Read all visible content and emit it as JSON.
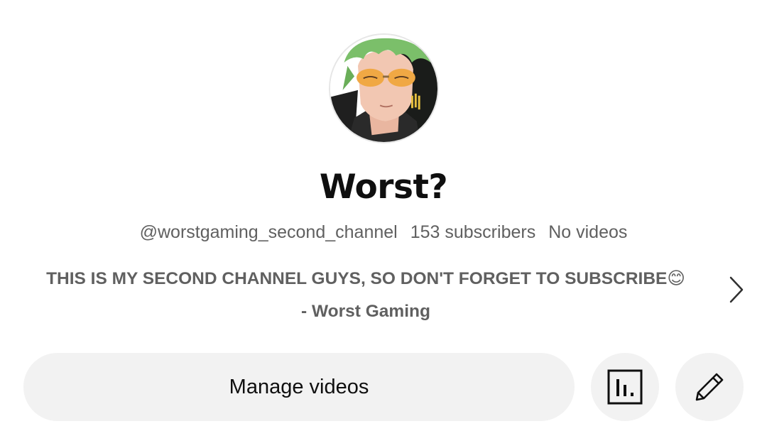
{
  "channel": {
    "name": "Worst?",
    "handle": "@worstgaming_second_channel",
    "subscribers": "153 subscribers",
    "videos": "No videos",
    "description_line1": "THIS IS MY SECOND CHANNEL GUYS, SO DON'T FORGET TO SUBSCRIBE😊",
    "description_line2": "- Worst Gaming"
  },
  "actions": {
    "manage_videos": "Manage videos"
  },
  "icons": {
    "avatar": "anime-character-avatar",
    "more": "chevron-right-icon",
    "analytics": "analytics-chart-icon",
    "edit": "pencil-icon"
  }
}
